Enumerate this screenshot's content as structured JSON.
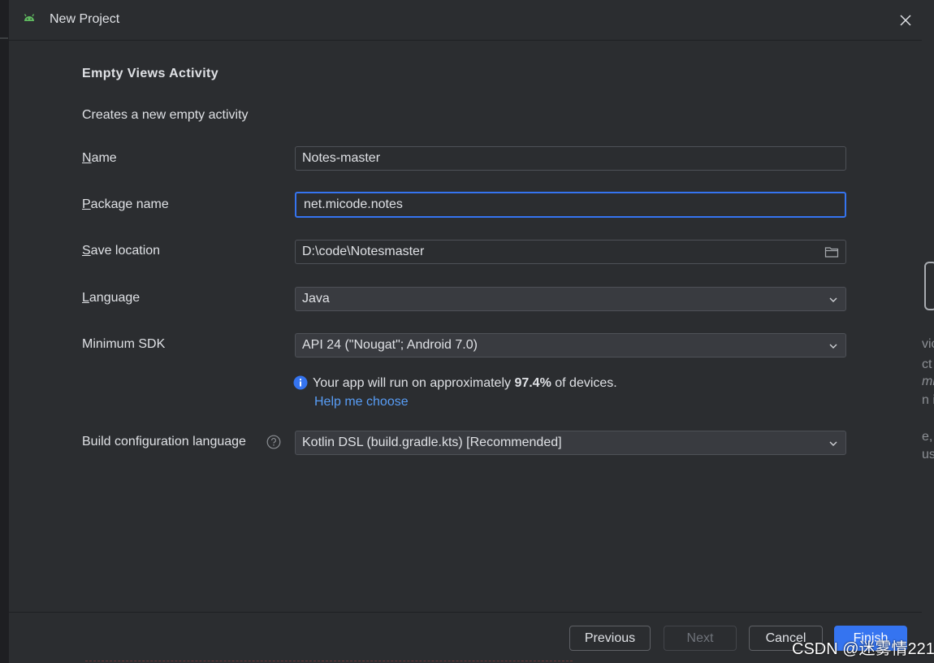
{
  "window": {
    "title": "New Project",
    "close_icon": "close-icon",
    "app_icon": "android-icon"
  },
  "template": {
    "name": "Empty Views Activity",
    "description": "Creates a new empty activity"
  },
  "form": {
    "name": {
      "mnemonic": "N",
      "rest": "ame",
      "value": "Notes-master"
    },
    "package": {
      "mnemonic": "P",
      "rest": "ackage name",
      "value": "net.micode.notes"
    },
    "save_location": {
      "mnemonic": "S",
      "rest": "ave location",
      "value": "D:\\code\\Notesmaster",
      "icon": "folder-icon"
    },
    "language": {
      "mnemonic": "L",
      "rest": "anguage",
      "value": "Java"
    },
    "min_sdk": {
      "label": "Minimum SDK",
      "value": "API 24 (\"Nougat\"; Android 7.0)"
    },
    "sdk_info": {
      "prefix": "Your app will run on approximately ",
      "percent": "97.4%",
      "suffix": " of devices.",
      "help_link": "Help me choose"
    },
    "build_config": {
      "label": "Build configuration language",
      "value": "Kotlin DSL (build.gradle.kts) [Recommended]"
    }
  },
  "footer": {
    "previous": "Previous",
    "next": "Next",
    "cancel": "Cancel",
    "finish": "Finish"
  },
  "watermark": "CSDN @迷雾情221",
  "background_fragments": [
    "vic",
    "ct",
    "mi",
    "n ir",
    "e,",
    "us"
  ],
  "colors": {
    "accent": "#3574f0",
    "link": "#589df6",
    "dialog_bg": "#2b2d30",
    "text": "#dfe1e5"
  }
}
